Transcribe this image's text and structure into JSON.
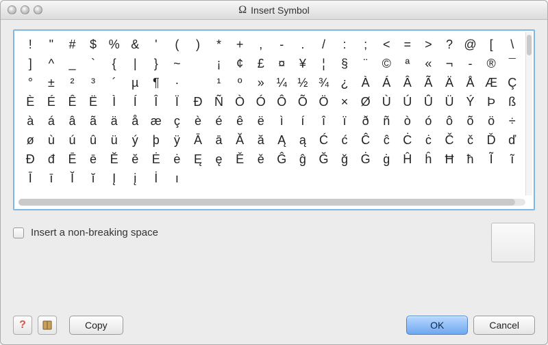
{
  "window": {
    "title": "Insert Symbol",
    "title_icon": "Ω"
  },
  "symbols": [
    "!",
    "\"",
    "#",
    "$",
    "%",
    "&",
    "'",
    "(",
    ")",
    "*",
    "+",
    ",",
    "-",
    ".",
    "/",
    ":",
    ";",
    "<",
    "=",
    ">",
    "?",
    "@",
    "[",
    "\\",
    "]",
    "^",
    "_",
    "`",
    "{",
    "|",
    "}",
    "~",
    "",
    "¡",
    "¢",
    "£",
    "¤",
    "¥",
    "¦",
    "§",
    "¨",
    "©",
    "ª",
    "«",
    "¬",
    "-",
    "®",
    "¯",
    "°",
    "±",
    "²",
    "³",
    "´",
    "µ",
    "¶",
    "·",
    "",
    "¹",
    "º",
    "»",
    "¼",
    "½",
    "¾",
    "¿",
    "À",
    "Á",
    "Â",
    "Ã",
    "Ä",
    "Å",
    "Æ",
    "Ç",
    "È",
    "É",
    "Ê",
    "Ë",
    "Ì",
    "Í",
    "Î",
    "Ï",
    "Ð",
    "Ñ",
    "Ò",
    "Ó",
    "Ô",
    "Õ",
    "Ö",
    "×",
    "Ø",
    "Ù",
    "Ú",
    "Û",
    "Ü",
    "Ý",
    "Þ",
    "ß",
    "à",
    "á",
    "â",
    "ã",
    "ä",
    "å",
    "æ",
    "ç",
    "è",
    "é",
    "ê",
    "ë",
    "ì",
    "í",
    "î",
    "ï",
    "ð",
    "ñ",
    "ò",
    "ó",
    "ô",
    "õ",
    "ö",
    "÷",
    "ø",
    "ù",
    "ú",
    "û",
    "ü",
    "ý",
    "þ",
    "ÿ",
    "Ā",
    "ā",
    "Ă",
    "ă",
    "Ą",
    "ą",
    "Ć",
    "ć",
    "Ĉ",
    "ĉ",
    "Ċ",
    "ċ",
    "Č",
    "č",
    "Ď",
    "ď",
    "Đ",
    "đ",
    "Ē",
    "ē",
    "Ĕ",
    "ĕ",
    "Ė",
    "ė",
    "Ę",
    "ę",
    "Ě",
    "ě",
    "Ĝ",
    "ĝ",
    "Ğ",
    "ğ",
    "Ġ",
    "ġ",
    "Ĥ",
    "ĥ",
    "Ħ",
    "ħ",
    "Ĩ",
    "ĩ",
    "Ī",
    "ī",
    "Ĭ",
    "ĭ",
    "Į",
    "į",
    "İ",
    "ı"
  ],
  "checkbox": {
    "label": "Insert a non-breaking space",
    "checked": false
  },
  "buttons": {
    "copy": "Copy",
    "ok": "OK",
    "cancel": "Cancel"
  },
  "icons": {
    "help": "?",
    "book": "book-icon"
  }
}
